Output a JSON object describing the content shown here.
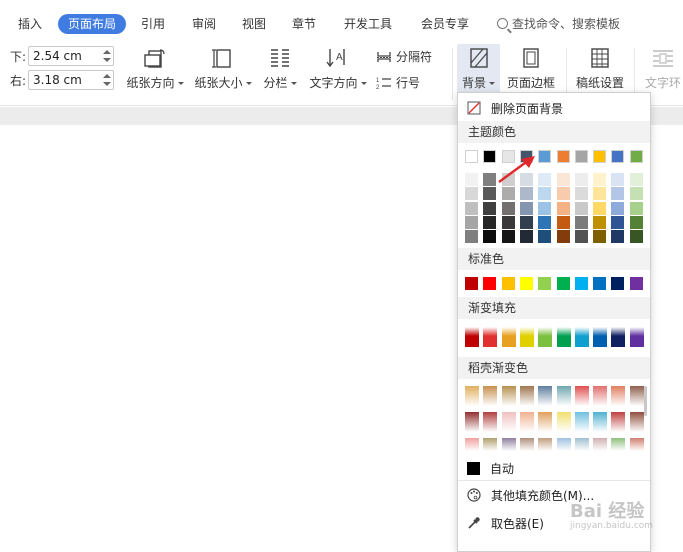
{
  "tabs": [
    {
      "label": "插入",
      "active": false
    },
    {
      "label": "页面布局",
      "active": true
    },
    {
      "label": "引用",
      "active": false
    },
    {
      "label": "审阅",
      "active": false
    },
    {
      "label": "视图",
      "active": false
    },
    {
      "label": "章节",
      "active": false
    },
    {
      "label": "开发工具",
      "active": false
    },
    {
      "label": "会员专享",
      "active": false
    }
  ],
  "search": {
    "label": "查找命令、搜索模板"
  },
  "margins": {
    "bottom_label": "下:",
    "bottom_value": "2.54 cm",
    "right_label": "右:",
    "right_value": "3.18 cm"
  },
  "ribbon": {
    "orientation": "纸张方向",
    "size": "纸张大小",
    "columns": "分栏",
    "text_direction": "文字方向",
    "separator": "分隔符",
    "line_number": "行号",
    "background": "背景",
    "page_border": "页面边框",
    "manuscript": "稿纸设置",
    "text_wrap": "文字环"
  },
  "menu": {
    "remove_bg": "删除页面背景",
    "theme_colors": "主题颜色",
    "standard_colors": "标准色",
    "gradient_fill": "渐变填充",
    "shell_gradient": "稻壳渐变色",
    "auto": "自动",
    "more_colors": "其他填充颜色(M)...",
    "eyedropper": "取色器(E)"
  },
  "watermark": {
    "text": "Bai 经验",
    "sub": "jingyan.baidu.com"
  },
  "colors": {
    "accent": "#3f7be0",
    "theme_row": [
      "#ffffff",
      "#000000",
      "#e7e6e6",
      "#44546a",
      "#5b9bd5",
      "#ed7d31",
      "#a5a5a5",
      "#ffc000",
      "#4472c4",
      "#70ad47"
    ],
    "theme_shades": [
      [
        "#f2f2f2",
        "#7f7f7f",
        "#d0cece",
        "#d6dce4",
        "#deebf6",
        "#fbe5d5",
        "#ededed",
        "#fff2cc",
        "#dae3f3",
        "#e2efd9"
      ],
      [
        "#d8d8d8",
        "#595959",
        "#aeabab",
        "#adb9ca",
        "#bdd7ee",
        "#f7cbac",
        "#dbdbdb",
        "#fee599",
        "#b4c6e7",
        "#c5e0b3"
      ],
      [
        "#bfbfbf",
        "#3f3f3f",
        "#757070",
        "#8496b0",
        "#9cc3e5",
        "#f4b183",
        "#c9c9c9",
        "#ffd965",
        "#8eaadb",
        "#a8d08d"
      ],
      [
        "#a5a5a5",
        "#262626",
        "#3a3838",
        "#323f4f",
        "#2e75b5",
        "#c55a11",
        "#7b7b7b",
        "#bf9000",
        "#2f5496",
        "#538135"
      ],
      [
        "#7f7f7f",
        "#0c0c0c",
        "#171616",
        "#222a35",
        "#1e4e79",
        "#833c0b",
        "#525252",
        "#7f6000",
        "#1f3864",
        "#375623"
      ]
    ],
    "standard": [
      "#c00000",
      "#ff0000",
      "#ffc000",
      "#ffff00",
      "#92d050",
      "#00b050",
      "#00b0f0",
      "#0070c0",
      "#002060",
      "#7030a0"
    ],
    "gradient": [
      "#c00000",
      "#e03030",
      "#e8a020",
      "#e0d000",
      "#7cc040",
      "#00a050",
      "#10a0d0",
      "#0060b0",
      "#102060",
      "#6030a0"
    ],
    "shell_row1": [
      "#e0b060",
      "#c89050",
      "#b89050",
      "#a07850",
      "#6080a0",
      "#70a8b0",
      "#e05050",
      "#e07070",
      "#e08060",
      "#906050"
    ],
    "shell_row2": [
      "#903030",
      "#b04040",
      "#f0c0c0",
      "#f0b090",
      "#e0a060",
      "#f0e070",
      "#70c0e0",
      "#50b0d0",
      "#c04040",
      "#905040"
    ],
    "shell_row3": [
      "#f0a0a0",
      "#b0a070",
      "#9080a0",
      "#b09080",
      "#c0a080",
      "#a0c0e0",
      "#a0c0d0",
      "#d0b0b0",
      "#90c080",
      "#d08070"
    ]
  }
}
